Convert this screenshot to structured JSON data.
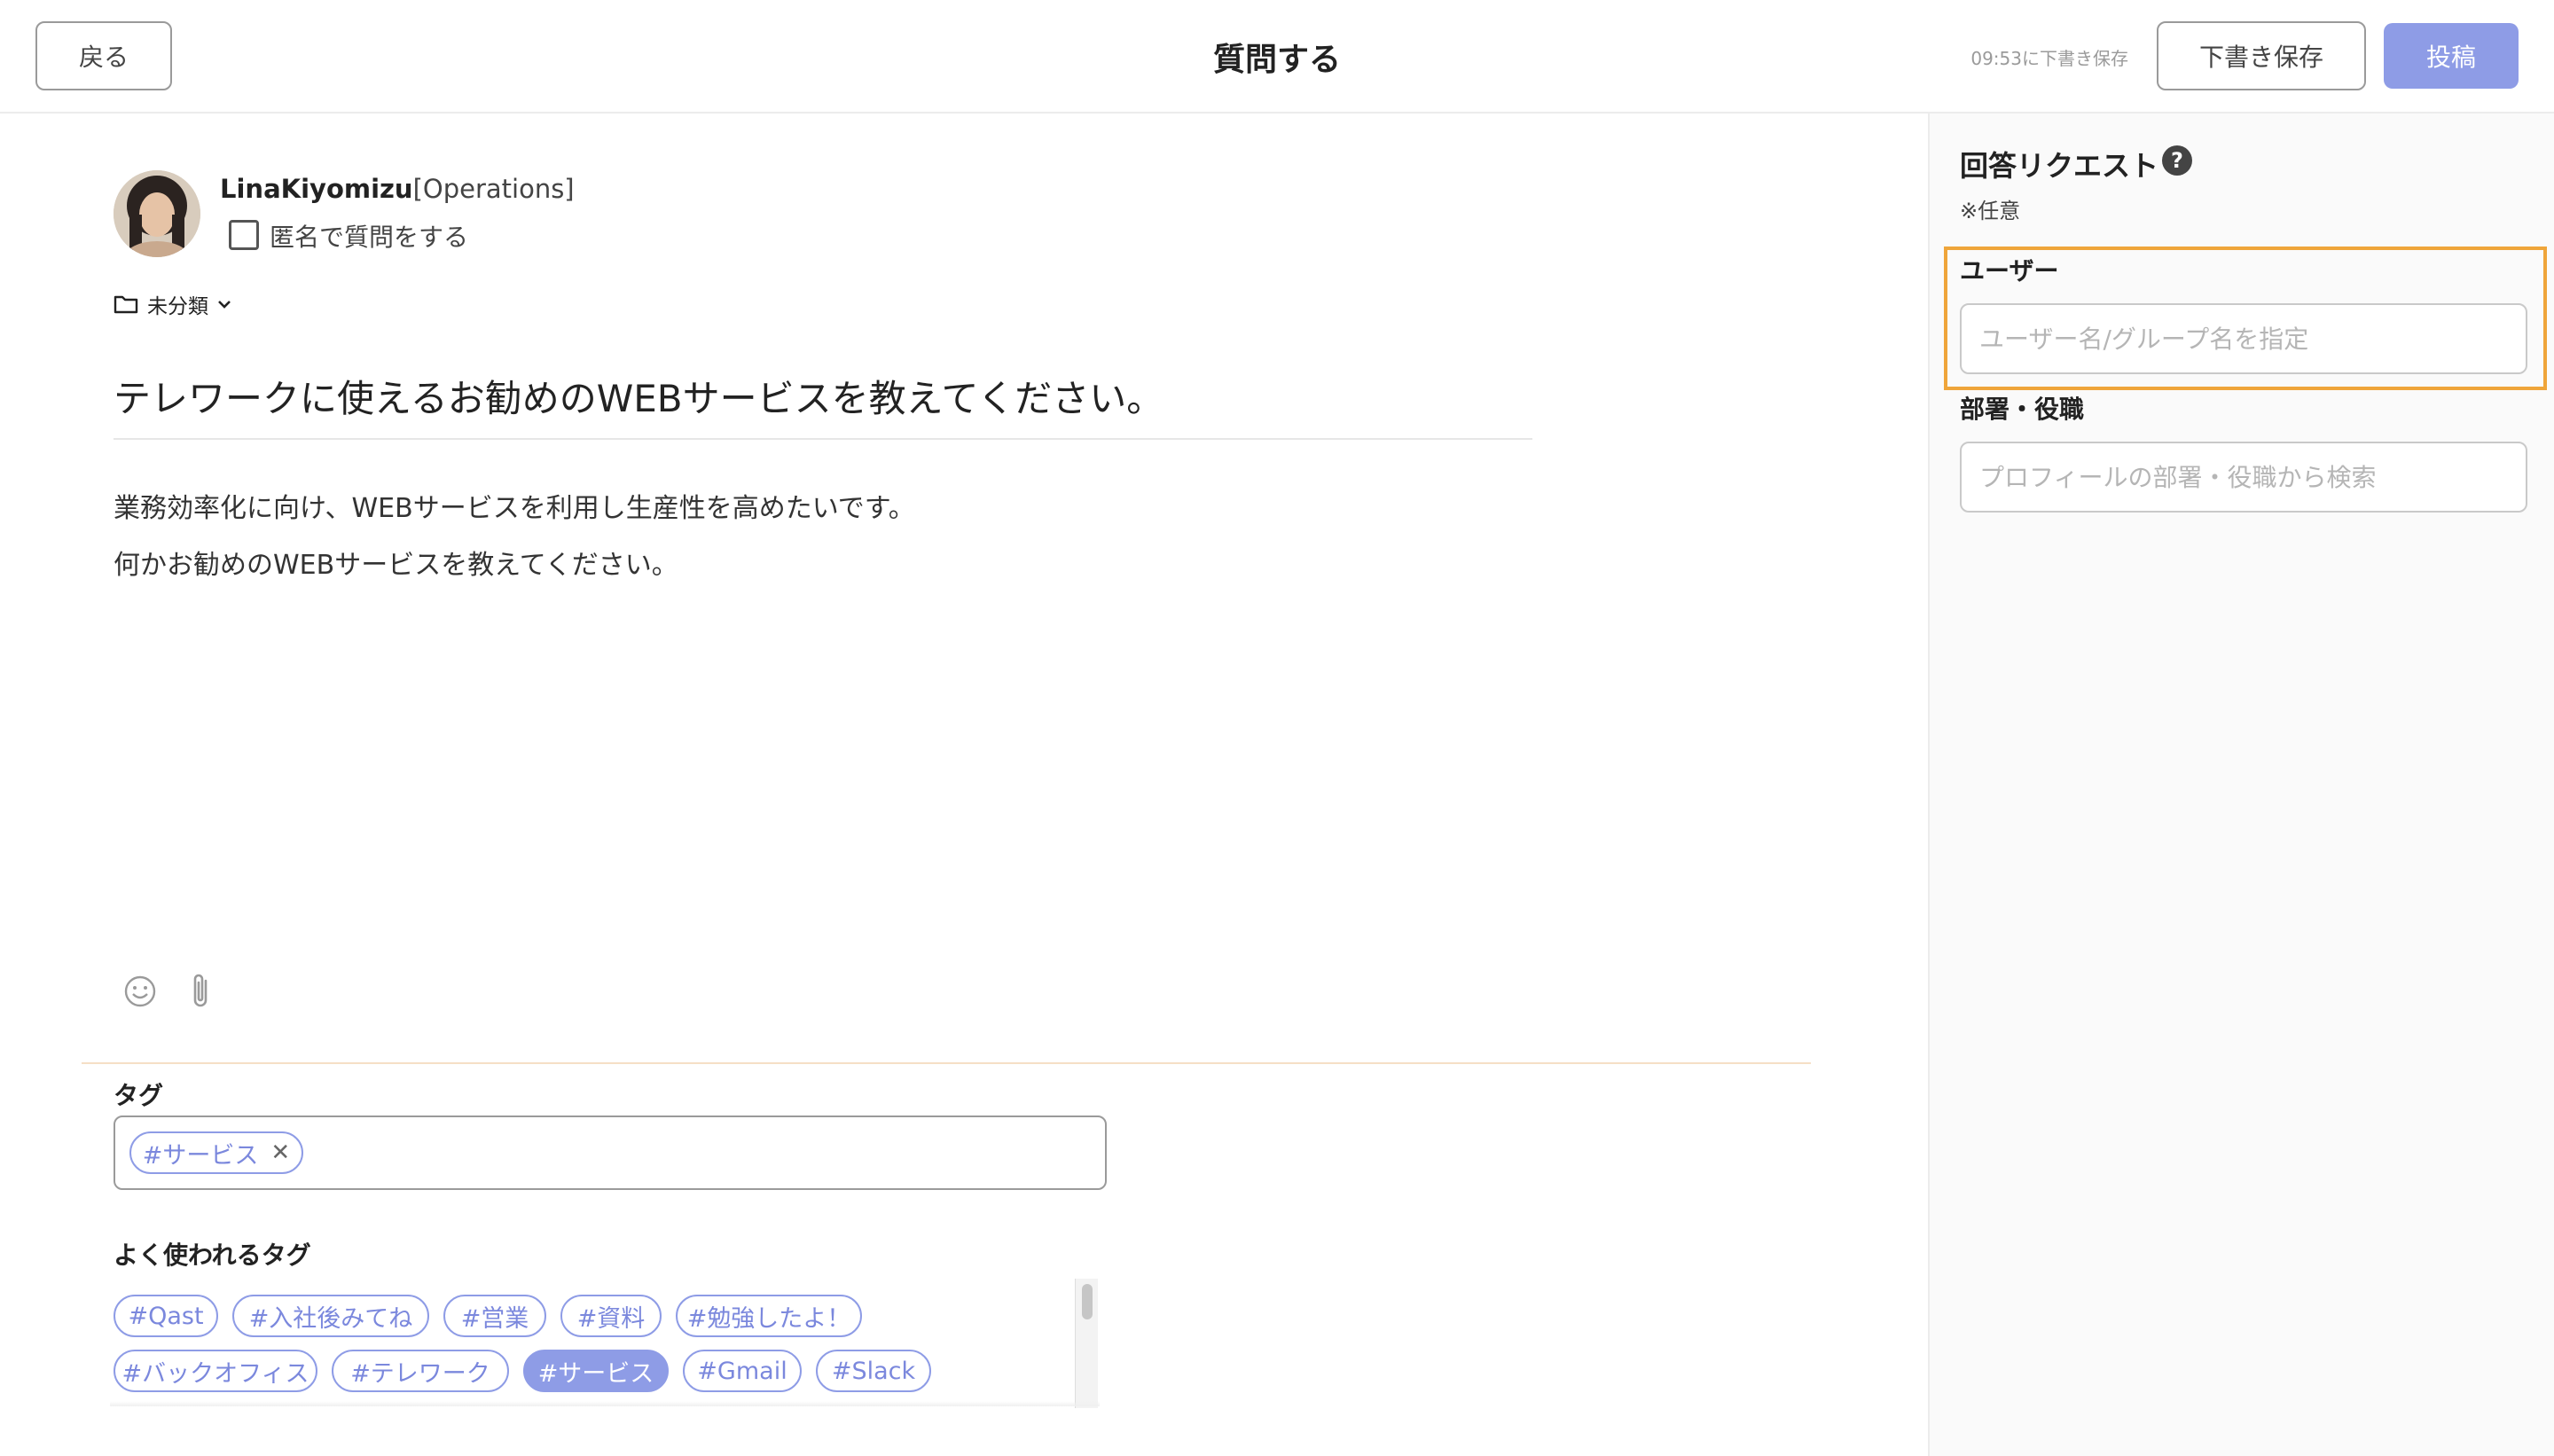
{
  "header": {
    "back_label": "戻る",
    "title": "質問する",
    "save_status": "09:53に下書き保存",
    "draft_label": "下書き保存",
    "post_label": "投稿"
  },
  "author": {
    "name": "LinaKiyomizu",
    "department": "[Operations]",
    "anonymous_label": "匿名で質問をする",
    "anonymous_checked": false
  },
  "category": "未分類",
  "question": {
    "title": "テレワークに使えるお勧めのWEBサービスを教えてください。",
    "body_lines": [
      "業務効率化に向け、WEBサービスを利用し生産性を高めたいです。",
      "何かお勧めのWEBサービスを教えてください。"
    ]
  },
  "tags": {
    "label": "タグ",
    "selected": [
      "#サービス"
    ],
    "frequent_label": "よく使われるタグ",
    "frequent": [
      "#Qast",
      "#入社後みてね",
      "#営業",
      "#資料",
      "#勉強したよ！",
      "#バックオフィス",
      "#テレワーク",
      "#サービス",
      "#Gmail",
      "#Slack"
    ]
  },
  "answer_request": {
    "title": "回答リクエスト",
    "help_icon": "?",
    "optional": "※任意",
    "user_label": "ユーザー",
    "user_placeholder": "ユーザー名/グループ名を指定",
    "dept_label": "部署・役職",
    "dept_placeholder": "プロフィールの部署・役職から検索"
  },
  "colors": {
    "accent": "#8e9ce6",
    "highlight": "#efa53a"
  }
}
